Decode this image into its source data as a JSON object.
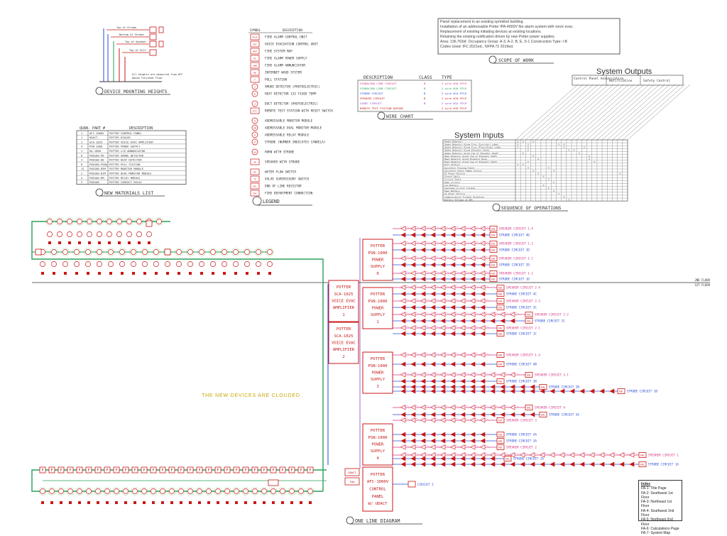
{
  "titles": {
    "mounting": "DEVICE MOUNTING HEIGHTS",
    "materials": "NEW MATERIALS LIST",
    "legend": "LEGEND",
    "scope": "SCOPE OF WORK",
    "wire": "WIRE CHART",
    "sequence": "SEQUENCE OF OPERATIONS",
    "oneline": "ONE LINE DIAGRAM"
  },
  "scope_lines": [
    "Panel replacement in an existing sprinkled building.",
    "Installation of an addressable Potter IPA-4000V fire alarm system with voice evac.",
    "Replacement of existing initiating devices at existing locations.",
    "Retaining the existing notification driven by new Potter power supplies.",
    "Area: 136,763sf.  Occupancy Group: A-3, A-2, B, E, S-1  Construction Type: I-B",
    "Codes Used: IFC 2021ed., NFPA 72 2019ed."
  ],
  "mounting_labels": [
    "Top of Strobe",
    "Bottom of Strobe",
    "Top of Speaker",
    "Top of Pull",
    "All heights are measured from AFF",
    "Above Finished Floor"
  ],
  "materials": {
    "headers": [
      "QUAN.",
      "PART #",
      "DESCRIPTION"
    ],
    "rows": [
      [
        "1",
        "AFC-1000V",
        "POTTER CONTROL PANEL"
      ],
      [
        "1",
        "UDACT",
        "POTTER DIALER"
      ],
      [
        "2",
        "SCA-1025",
        "POTTER VOICE EVAC AMPLIFIER"
      ],
      [
        "4",
        "PSN-1000",
        "POTTER POWER SUPPLY"
      ],
      [
        "1",
        "RA-1000",
        "POTTER LCD ANNUNCIATOR"
      ],
      [
        "6",
        "PAD100-PD",
        "POTTER SMOKE DETECTOR"
      ],
      [
        "4",
        "PAD100-HD",
        "POTTER HEAT DETECTOR"
      ],
      [
        "8",
        "PAD100-PSDA",
        "POTTER PULL STATION"
      ],
      [
        "12",
        "PAD100-MIM",
        "POTTER MONITOR MODULE"
      ],
      [
        "2",
        "PAD100-DIM",
        "POTTER DUAL MONITOR MODULE"
      ],
      [
        "4",
        "PAD100-RM",
        "POTTER RELAY MODULE"
      ],
      [
        "2",
        "PAD100",
        "POTTER CONTACT RELAY"
      ]
    ]
  },
  "legend": {
    "headers": [
      "SYMBOL",
      "DESCRIPTION"
    ],
    "items": [
      {
        "sym": "FACP",
        "desc": "FIRE ALARM CONTROL UNIT"
      },
      {
        "sym": "VEC",
        "desc": "VOICE EVACUATION CONTROL UNIT"
      },
      {
        "sym": "MAP",
        "desc": "FIRE SYSTEM MAP"
      },
      {
        "sym": "PS",
        "desc": "FIRE ALARM POWER SUPPLY"
      },
      {
        "sym": "ANN",
        "desc": "FIRE ALARM ANNUNCIATOR"
      },
      {
        "sym": "KB",
        "desc": "INTERNET WOOD SYSTEM"
      },
      {
        "sym": "F",
        "desc": "PULL STATION"
      },
      {
        "sym": "S",
        "desc": "SMOKE DETECTOR (PHOTOELECTRIC)"
      },
      {
        "sym": "H",
        "desc": "HEAT DETECTOR 135 FIXED TEMP"
      },
      {
        "sym": "D",
        "desc": "DUCT DETECTOR (PHOTOELECTRIC)"
      },
      {
        "sym": "RTS",
        "desc": "REMOTE TEST STATION WITH RESET SWITCH"
      },
      {
        "sym": "M",
        "desc": "ADDRESSABLE MONITOR MODULE"
      },
      {
        "sym": "DM",
        "desc": "ADDRESSABLE DUAL MONITOR MODULE"
      },
      {
        "sym": "R",
        "desc": "ADDRESSABLE RELAY MODULE"
      },
      {
        "sym": "ST",
        "desc": "STROBE (NUMBER INDICATES CANDELA)"
      },
      {
        "sym": "HS",
        "desc": "HORN WITH STROBE"
      },
      {
        "sym": "SP",
        "desc": "SPEAKER WITH STROBE"
      },
      {
        "sym": "WF",
        "desc": "WATER FLOW SWITCH"
      },
      {
        "sym": "TS",
        "desc": "VALVE SUPERVISORY SWITCH"
      },
      {
        "sym": "EOL",
        "desc": "END OF LINE RESISTOR"
      },
      {
        "sym": "FDC",
        "desc": "FIRE DEPARTMENT CONNECTION"
      }
    ]
  },
  "wire_chart": {
    "headers": [
      "DESCRIPTION",
      "CLASS",
      "TYPE"
    ],
    "rows": [
      {
        "desc": "SIGNALING LINE CIRCUIT",
        "cls": "B",
        "type": "2 wire #16 FPLP",
        "color": "#d63384"
      },
      {
        "desc": "SIGNALING LINE CIRCUIT",
        "cls": "B",
        "type": "2 wire #16 FPLP",
        "color": "#2aa05a"
      },
      {
        "desc": "STROBE CIRCUIT",
        "cls": "B",
        "type": "2 wire #14 FPLP",
        "color": "#2a4bd7"
      },
      {
        "desc": "SPEAKER CIRCUIT",
        "cls": "B",
        "type": "2 wire #16 FPLP",
        "color": "#c81818"
      },
      {
        "desc": "24VDC CIRCUIT",
        "cls": "B",
        "type": "2 wire #14 FPLP",
        "color": "#8a44c8"
      },
      {
        "desc": "REMOTE TEST STATION WIRING",
        "cls": "",
        "type": "2 wire #18 FPLP",
        "color": "#c81818"
      }
    ]
  },
  "sequence": {
    "outputs_title": "System Outputs",
    "inputs_title": "System Inputs",
    "output_groups": [
      "Control Panel Annunciation",
      "Notification",
      "Safety Control"
    ],
    "inputs": [
      "Smoke Detector",
      "Smoke Detector Alarm Fire (Corridor) Lobby",
      "Smoke Detector Alarm Fire (Floor/Area) Lobby",
      "Smoke Detector Alarm Elevator Shaft",
      "Smoke Detector Alarm Top of Elevator Shaft",
      "Heat Detector Alarm Top of Elevator Shaft",
      "Heat Detector Alarm Elevator Room",
      "Heat Detector Alarm Top of Elevator Shaft",
      "Pull Station",
      "Sprinkler Flowing Alarm",
      "Sprinkler Valve Tamper Switch",
      "AC Power Failure",
      "Ground Fault",
      "Circuit Fault",
      "Open Circuit",
      "Low Battery",
      "Overhead Circuit Trouble",
      "Open Battery",
      "AC Power Failure",
      "Communication Trouble Condition",
      "Battery Voltage at 80%"
    ]
  },
  "oneline": {
    "floor_2": "2ND FLOOR",
    "floor_1": "1ST FLOOR",
    "note": "THE NEW DEVICES ARE CLOUDED",
    "power_supplies": [
      {
        "line1": "POTTER",
        "line2": "PSN-1000",
        "line3": "POWER",
        "line4": "SUPPLY",
        "num": "0"
      },
      {
        "line1": "POTTER",
        "line2": "PSN-1000",
        "line3": "POWER",
        "line4": "SUPPLY",
        "num": "1"
      },
      {
        "line1": "POTTER",
        "line2": "PSN-1000",
        "line3": "POWER",
        "line4": "SUPPLY",
        "num": "3"
      },
      {
        "line1": "POTTER",
        "line2": "PSN-1000",
        "line3": "POWER",
        "line4": "SUPPLY",
        "num": "4"
      }
    ],
    "amplifiers": [
      {
        "line1": "POTTER",
        "line2": "SCA-1025",
        "line3": "VOICE EVAC",
        "line4": "AMPLIFIER",
        "num": "1"
      },
      {
        "line1": "POTTER",
        "line2": "SCA-1025",
        "line3": "VOICE EVAC",
        "line4": "AMPLIFIER",
        "num": "2"
      }
    ],
    "panel": {
      "line1": "POTTER",
      "line2": "AFC-1000V",
      "line3": "CONTROL",
      "line4": "PANEL",
      "line5": "W/ UDACT"
    },
    "panel_tags": [
      "UDACT",
      "FAA"
    ],
    "circuit_1": "CIRCUIT 1",
    "circuits": [
      {
        "eol": "EOL",
        "label": "SPEAKER CIRCUIT 1-4",
        "color": "#d63384"
      },
      {
        "eol": "EOL",
        "label": "STROBE CIRCUIT 4D",
        "color": "#2a4bd7"
      },
      {
        "eol": "EOL",
        "label": "SPEAKER CIRCUIT 1-3",
        "color": "#d63384"
      },
      {
        "eol": "EOL",
        "label": "STROBE CIRCUIT 3D",
        "color": "#2a4bd7"
      },
      {
        "eol": "EOL",
        "label": "SPEAKER CIRCUIT 1-2",
        "color": "#d63384"
      },
      {
        "eol": "EOL",
        "label": "STROBE CIRCUIT 2D",
        "color": "#2a4bd7"
      },
      {
        "eol": "EOL",
        "label": "SPEAKER CIRCUIT 1-1",
        "color": "#d63384"
      },
      {
        "eol": "EOL",
        "label": "STROBE CIRCUIT 1D",
        "color": "#2a4bd7"
      },
      {
        "eol": "EOL",
        "label": "SPEAKER CIRCUIT 2-4",
        "color": "#d63384"
      },
      {
        "eol": "EOL",
        "label": "STROBE CIRCUIT 4C",
        "color": "#2a4bd7"
      },
      {
        "eol": "EOL",
        "label": "SPEAKER CIRCUIT 2-3",
        "color": "#d63384"
      },
      {
        "eol": "EOL",
        "label": "STROBE CIRCUIT 3C",
        "color": "#2a4bd7"
      },
      {
        "eol": "EOL",
        "label": "SPEAKER CIRCUIT 2-2",
        "color": "#d63384"
      },
      {
        "eol": "EOL",
        "label": "STROBE CIRCUIT 2C",
        "color": "#2a4bd7"
      },
      {
        "eol": "EOL",
        "label": "SPEAKER CIRCUIT 2-1",
        "color": "#d63384"
      },
      {
        "eol": "EOL",
        "label": "STROBE CIRCUIT 1C",
        "color": "#2a4bd7"
      },
      {
        "eol": "EOL",
        "label": "SPEAKER CIRCUIT 1-4",
        "color": "#d63384"
      },
      {
        "eol": "EOL",
        "label": "STROBE CIRCUIT 4B",
        "color": "#2a4bd7"
      },
      {
        "eol": "EOL",
        "label": "STROBE CIRCUIT 3B",
        "color": "#2a4bd7"
      },
      {
        "eol": "EOL",
        "label": "SPEAKER CIRCUIT 3-1",
        "color": "#d63384"
      },
      {
        "eol": "EOL",
        "label": "STROBE CIRCUIT 2B",
        "color": "#2a4bd7"
      },
      {
        "eol": "EOL",
        "label": "STROBE CIRCUIT 1B",
        "color": "#2a4bd7"
      },
      {
        "eol": "EOL",
        "label": "SPEAKER CIRCUIT 4",
        "color": "#d63384"
      },
      {
        "eol": "EOL",
        "label": "STROBE CIRCUIT 5A",
        "color": "#2a4bd7"
      },
      {
        "eol": "EOL",
        "label": "SPEAKER CIRCUIT 3",
        "color": "#d63384"
      },
      {
        "eol": "EOL",
        "label": "STROBE CIRCUIT 4A",
        "color": "#2a4bd7"
      },
      {
        "eol": "EOL",
        "label": "STROBE CIRCUIT 3A",
        "color": "#2a4bd7"
      },
      {
        "eol": "EOL",
        "label": "SPEAKER CIRCUIT 2",
        "color": "#d63384"
      },
      {
        "eol": "EOL",
        "label": "STROBE CIRCUIT 2A",
        "color": "#2a4bd7"
      },
      {
        "eol": "EOL",
        "label": "SPEAKER CIRCUIT 1",
        "color": "#d63384"
      },
      {
        "eol": "EOL",
        "label": "STROBE CIRCUIT 1A",
        "color": "#2a4bd7"
      }
    ]
  },
  "index": {
    "title": "Index",
    "items": [
      "FA-1: Title Page",
      "FA-2: Southwest 1st Floor",
      "FA-3: Northeast 1st Floor",
      "FA-4: Southwest 2nd Floor",
      "FA-5: Northeast 2nd Floor",
      "FA-6: Calculations Page",
      "FA-7: System Map"
    ]
  },
  "colors": {
    "red": "#c81818",
    "pink": "#d63384",
    "blue": "#2a4bd7",
    "green": "#2aa05a",
    "lightgreen": "#7fd07f",
    "line": "#333333",
    "yellow": "#c8a400"
  }
}
